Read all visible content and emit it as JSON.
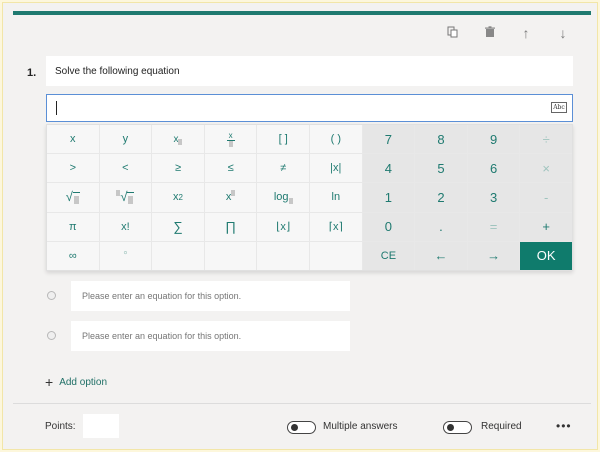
{
  "colors": {
    "accent": "#1f7a70",
    "ok_button": "#0f7b6c",
    "focus_border": "#5b8fd6"
  },
  "toolbar": {
    "copy_icon": "copy-icon",
    "delete_icon": "trash-icon",
    "up_icon": "arrow-up-icon",
    "down_icon": "arrow-down-icon"
  },
  "question": {
    "number": "1.",
    "title": "Solve the following equation"
  },
  "equation_input": {
    "value": "",
    "abc_label": "Abc"
  },
  "keypad": {
    "k": {
      "x": "x",
      "y": "y",
      "sub": "x",
      "frac_top": "x",
      "brackets": "[ ]",
      "parens": "( )",
      "n7": "7",
      "n8": "8",
      "n9": "9",
      "div": "÷",
      "gt": ">",
      "lt": "<",
      "ge": "≥",
      "le": "≤",
      "ne": "≠",
      "abs": "|x|",
      "n4": "4",
      "n5": "5",
      "n6": "6",
      "mul": "×",
      "sqrt": "√",
      "nroot": "√",
      "sq_base": "x",
      "sq_exp": "2",
      "pow_base": "x",
      "log": "log",
      "ln": "ln",
      "n1": "1",
      "n2": "2",
      "n3": "3",
      "minus": "-",
      "pi": "π",
      "fact": "x!",
      "sum": "∑",
      "prod": "∏",
      "floor": "⌊x⌋",
      "ceil": "⌈x⌉",
      "n0": "0",
      "dot": ".",
      "eq": "=",
      "plus": "+",
      "inf": "∞",
      "deg": "°",
      "ce": "CE",
      "left": "←",
      "right": "→",
      "ok": "OK"
    }
  },
  "options": [
    {
      "placeholder": "Please enter an equation for this option."
    },
    {
      "placeholder": "Please enter an equation for this option."
    }
  ],
  "add_option": {
    "label": "Add option"
  },
  "footer": {
    "points_label": "Points:",
    "points_value": "",
    "multiple_answers_label": "Multiple answers",
    "required_label": "Required",
    "more": "•••"
  }
}
